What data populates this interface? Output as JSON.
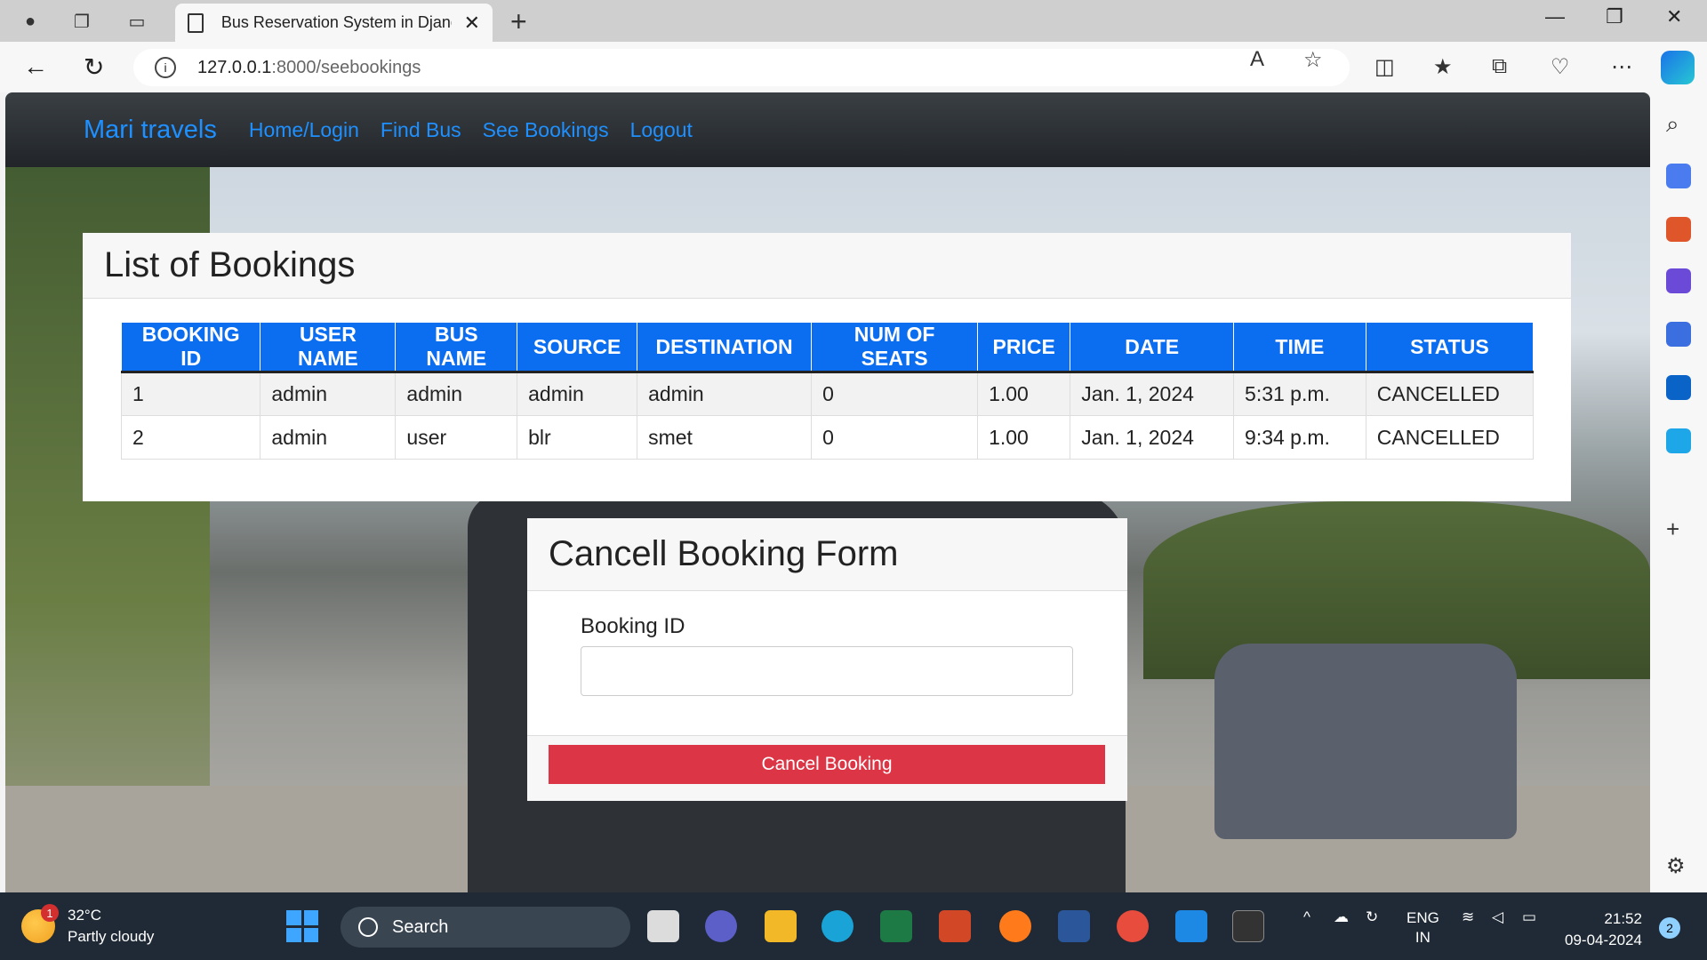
{
  "browser": {
    "tab_title": "Bus Reservation System in Django",
    "url_host": "127.0.0.1",
    "url_path": ":8000/seebookings"
  },
  "navbar": {
    "brand": "Mari travels",
    "links": [
      "Home/Login",
      "Find Bus",
      "See Bookings",
      "Logout"
    ]
  },
  "bookings": {
    "title": "List of Bookings",
    "columns": [
      "BOOKING ID",
      "USER NAME",
      "BUS NAME",
      "SOURCE",
      "DESTINATION",
      "NUM OF SEATS",
      "PRICE",
      "DATE",
      "TIME",
      "STATUS"
    ],
    "rows": [
      [
        "1",
        "admin",
        "admin",
        "admin",
        "admin",
        "0",
        "1.00",
        "Jan. 1, 2024",
        "5:31 p.m.",
        "CANCELLED"
      ],
      [
        "2",
        "admin",
        "user",
        "blr",
        "smet",
        "0",
        "1.00",
        "Jan. 1, 2024",
        "9:34 p.m.",
        "CANCELLED"
      ]
    ]
  },
  "cancel_form": {
    "title": "Cancell Booking Form",
    "field_label": "Booking ID",
    "field_value": "",
    "submit_label": "Cancel Booking"
  },
  "taskbar": {
    "weather_temp": "32°C",
    "weather_desc": "Partly cloudy",
    "weather_badge": "1",
    "search_label": "Search",
    "lang_1": "ENG",
    "lang_2": "IN",
    "time": "21:52",
    "date": "09-04-2024",
    "notification_count": "2"
  },
  "colors": {
    "accent": "#0b6df0",
    "danger": "#dc3545",
    "brand_link": "#1e90ff"
  }
}
